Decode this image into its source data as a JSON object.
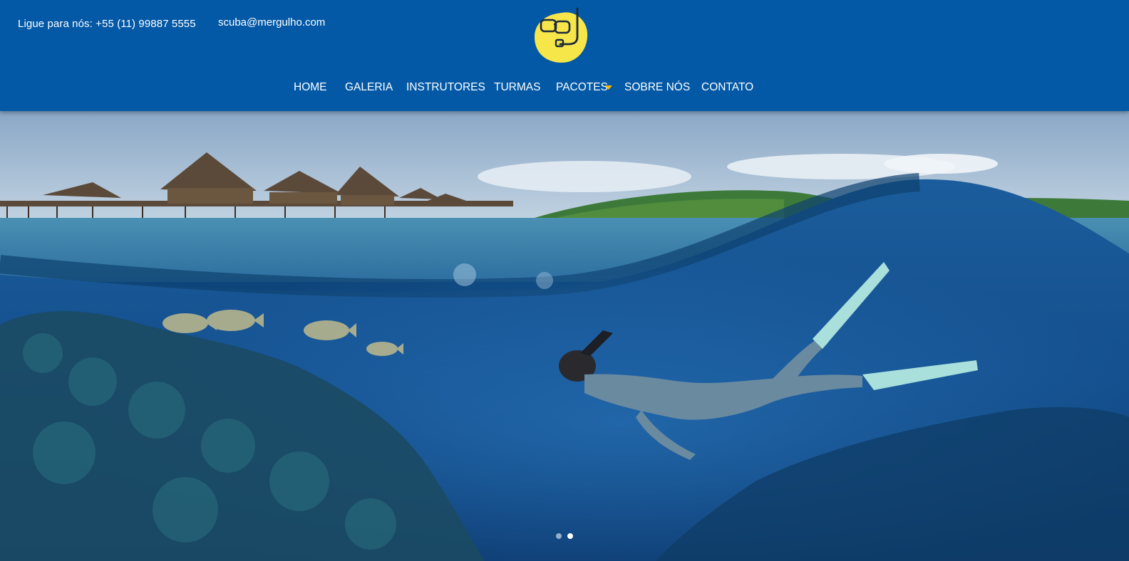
{
  "header": {
    "phone_text": "Ligue para nós: +55 (11) 99887 5555",
    "email_text": "scuba@mergulho.com",
    "logo_icon": "snorkel-mask-icon",
    "background_color": "#0359a6",
    "logo_color": "#f7e64a"
  },
  "nav": {
    "items": [
      {
        "label": "HOME"
      },
      {
        "label": "GALERIA"
      },
      {
        "label": "INSTRUTORES"
      },
      {
        "label": "TURMAS"
      },
      {
        "label": "PACOTES",
        "has_dropdown": true
      },
      {
        "label": "SOBRE NÓS"
      },
      {
        "label": "CONTATO"
      }
    ],
    "dropdown_caret_color": "#f5b400"
  },
  "hero": {
    "image_description_icon": "underwater-snorkeler-image",
    "slider": {
      "slide_count": 2,
      "active_index": 1
    }
  }
}
